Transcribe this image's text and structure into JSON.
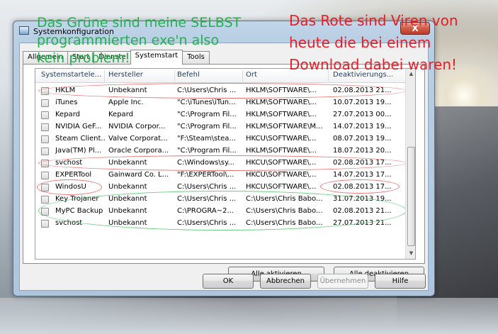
{
  "window": {
    "title": "Systemkonfiguration",
    "close_label": "X"
  },
  "tabs": [
    "Allgemein",
    "Start",
    "Dienste",
    "Systemstart",
    "Tools"
  ],
  "active_tab": "Systemstart",
  "columns": [
    "Systemstartele...",
    "Hersteller",
    "Befehl",
    "Ort",
    "Deaktivierungs..."
  ],
  "rows": [
    {
      "name": "HKLM",
      "vendor": "Unbekannt",
      "command": "C:\\Users\\Chris ...",
      "location": "HKLM\\SOFTWARE\\...",
      "date": "02.08.2013 21..."
    },
    {
      "name": "iTunes",
      "vendor": "Apple Inc.",
      "command": "\"C:\\iTunes\\iTun...",
      "location": "HKLM\\SOFTWARE\\...",
      "date": "10.07.2013 19..."
    },
    {
      "name": "Kepard",
      "vendor": "Kepard",
      "command": "\"C:\\Program Fil...",
      "location": "HKLM\\SOFTWARE\\...",
      "date": "27.07.2013 00..."
    },
    {
      "name": "NVIDIA GeF...",
      "vendor": "NVIDIA Corpor...",
      "command": "\"C:\\Program Fil...",
      "location": "HKLM\\SOFTWARE\\M...",
      "date": "14.07.2013 19..."
    },
    {
      "name": "Steam Client...",
      "vendor": "Valve Corporat...",
      "command": "\"F:\\Steam\\stea...",
      "location": "HKCU\\SOFTWARE\\...",
      "date": "08.07.2013 19..."
    },
    {
      "name": "Java(TM) Pl...",
      "vendor": "Oracle Corpora...",
      "command": "\"C:\\Program Fil...",
      "location": "HKLM\\SOFTWARE\\...",
      "date": "18.07.2013 20..."
    },
    {
      "name": "svchost",
      "vendor": "Unbekannt",
      "command": "C:\\Windows\\sy...",
      "location": "HKCU\\SOFTWARE\\...",
      "date": "02.08.2013 17..."
    },
    {
      "name": "EXPERTool",
      "vendor": "Gainward Co. L...",
      "command": "\"F:\\EXPERTool\\...",
      "location": "HKCU\\SOFTWARE\\...",
      "date": "14.07.2013 17..."
    },
    {
      "name": "WindosU",
      "vendor": "Unbekannt",
      "command": "C:\\Users\\Chris ...",
      "location": "HKCU\\SOFTWARE\\...",
      "date": "02.08.2013 17..."
    },
    {
      "name": "Key Trojaner",
      "vendor": "Unbekannt",
      "command": "C:\\Users\\Chris ...",
      "location": "C:\\Users\\Chris Babo...",
      "date": "31.07.2013 19..."
    },
    {
      "name": "MyPC Backup",
      "vendor": "Unbekannt",
      "command": "C:\\PROGRA~2...",
      "location": "C:\\Users\\Chris Babo...",
      "date": "02.08.2013 21..."
    },
    {
      "name": "svchost",
      "vendor": "Unbekannt",
      "command": "C:\\Users\\Chris ...",
      "location": "C:\\Users\\Chris Babo...",
      "date": "27.07.2013 21..."
    }
  ],
  "buttons": {
    "enable_all": "Alle aktivieren",
    "disable_all": "Alle deaktivieren",
    "ok": "OK",
    "cancel": "Abbrechen",
    "apply": "Übernehmen",
    "help": "Hilfe"
  },
  "annotations": {
    "green": [
      "Das Grüne sind meine SELBST",
      "programmierten exe'n also",
      "kein problem!"
    ],
    "red": [
      "Das Rote sind Viren von",
      "heute die bei einem",
      "Download dabei waren!"
    ]
  },
  "colors": {
    "annotation_green": "#23b14d",
    "annotation_red": "#ed1c24",
    "circle_red": "#e64646",
    "circle_green": "#3cbe5a"
  },
  "icons": {
    "title": "msconfig-icon",
    "close": "close-icon",
    "scroll_up": "scroll-up-arrow-icon",
    "scroll_down": "scroll-down-arrow-icon"
  }
}
